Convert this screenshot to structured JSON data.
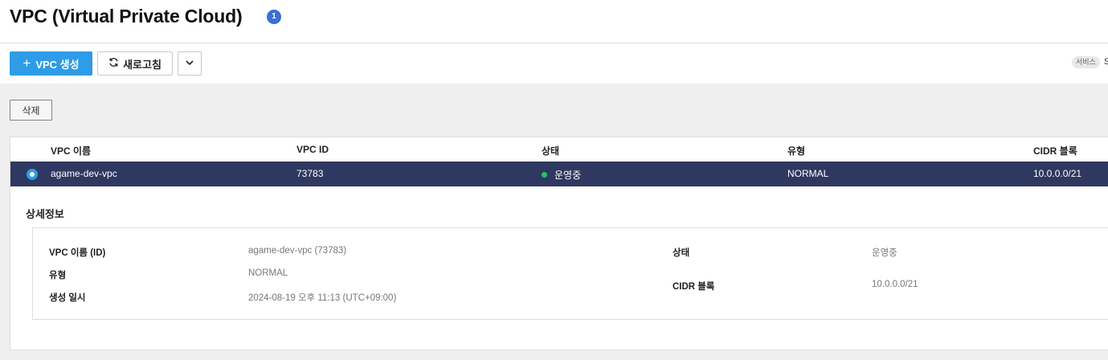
{
  "header": {
    "title": "VPC (Virtual Private Cloud)",
    "count": "1"
  },
  "toolbar": {
    "create_label": "VPC 생성",
    "refresh_label": "새로고침",
    "service_tag": "서비스",
    "service_tag_extra": "S"
  },
  "actions": {
    "delete_label": "삭제"
  },
  "table": {
    "columns": [
      "VPC 이름",
      "VPC ID",
      "상태",
      "유형",
      "CIDR 블록"
    ],
    "rows": [
      {
        "name": "agame-dev-vpc",
        "id": "73783",
        "status": "운영중",
        "type": "NORMAL",
        "cidr": "10.0.0.0/21",
        "selected": true
      }
    ]
  },
  "detail": {
    "title": "상세정보",
    "fields": {
      "name_id_label": "VPC 이름 (ID)",
      "name_id_value": "agame-dev-vpc (73783)",
      "type_label": "유형",
      "type_value": "NORMAL",
      "created_label": "생성 일시",
      "created_value": "2024-08-19 오후 11:13 (UTC+09:00)",
      "status_label": "상태",
      "status_value": "운영중",
      "cidr_label": "CIDR 블록",
      "cidr_value": "10.0.0.0/21"
    }
  },
  "colors": {
    "primary": "#2e9ce6",
    "selected_row": "#2f3860",
    "status_running": "#22c55e",
    "badge": "#3b6fd4"
  },
  "icons": {
    "create": "plus-icon",
    "refresh": "refresh-icon",
    "more": "chevron-down-icon",
    "radio": "radio-selected-icon",
    "status": "status-dot-icon"
  }
}
